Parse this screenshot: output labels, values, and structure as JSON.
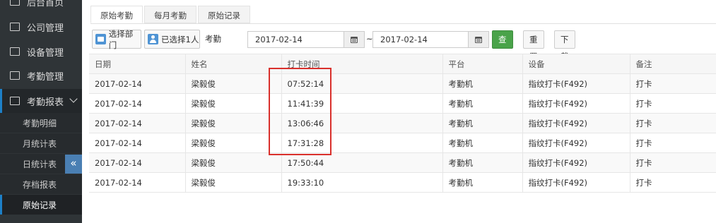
{
  "sidebar": {
    "top_cut_label": "后台首页",
    "items": [
      {
        "label": "公司管理",
        "icon": "building-icon"
      },
      {
        "label": "设备管理",
        "icon": "monitor-icon"
      },
      {
        "label": "考勤管理",
        "icon": "calendar-icon"
      },
      {
        "label": "考勤报表",
        "icon": "chart-icon"
      }
    ],
    "sub_items": [
      "考勤明细",
      "月统计表",
      "日统计表",
      "存档报表",
      "原始记录"
    ],
    "collapse_glyph": "«",
    "accent": "#1d80c8"
  },
  "tabs": [
    "原始考勤",
    "每月考勤",
    "原始记录"
  ],
  "toolbar": {
    "select_dept": "选择部门",
    "selected_people": "已选择1人",
    "time_label": "考勤时间：",
    "start_date": "2017-02-14",
    "range_sep": "~",
    "end_date": "2017-02-14",
    "query": "查询",
    "reset": "重置",
    "download": "下载"
  },
  "table": {
    "columns": [
      "日期",
      "姓名",
      "打卡时间",
      "平台",
      "设备",
      "备注"
    ],
    "rows": [
      [
        "2017-02-14",
        "梁毅俊",
        "07:52:14",
        "考勤机",
        "指纹打卡(F492)",
        "打卡"
      ],
      [
        "2017-02-14",
        "梁毅俊",
        "11:41:39",
        "考勤机",
        "指纹打卡(F492)",
        "打卡"
      ],
      [
        "2017-02-14",
        "梁毅俊",
        "13:06:46",
        "考勤机",
        "指纹打卡(F492)",
        "打卡"
      ],
      [
        "2017-02-14",
        "梁毅俊",
        "17:31:28",
        "考勤机",
        "指纹打卡(F492)",
        "打卡"
      ],
      [
        "2017-02-14",
        "梁毅俊",
        "17:50:44",
        "考勤机",
        "指纹打卡(F492)",
        "打卡"
      ],
      [
        "2017-02-14",
        "梁毅俊",
        "19:33:10",
        "考勤机",
        "指纹打卡(F492)",
        "打卡"
      ]
    ]
  },
  "colors": {
    "primary_button": "#4aa34a",
    "highlight": "#d9302c"
  }
}
